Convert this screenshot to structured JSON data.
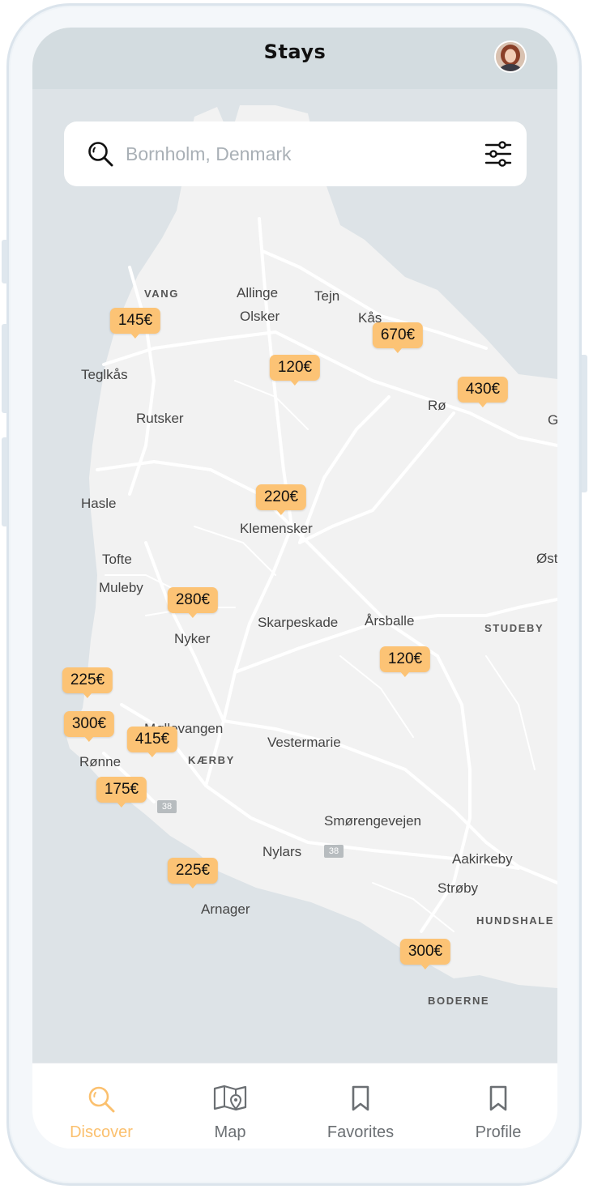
{
  "app": {
    "title": "Stays"
  },
  "search": {
    "placeholder": "Bornholm, Denmark",
    "value": ""
  },
  "colors": {
    "accent": "#fcc375",
    "active_tab": "#fbc06e",
    "map_water": "#dde3e7",
    "map_land": "#f2f2f2"
  },
  "map": {
    "places": [
      {
        "label": "VANG",
        "caps": true
      },
      {
        "label": "Allinge"
      },
      {
        "label": "Tejn"
      },
      {
        "label": "Olsker"
      },
      {
        "label": "Kås"
      },
      {
        "label": "Teglkås"
      },
      {
        "label": "Rø"
      },
      {
        "label": "G"
      },
      {
        "label": "Rutsker"
      },
      {
        "label": "Hasle"
      },
      {
        "label": "Klemensker"
      },
      {
        "label": "Øst"
      },
      {
        "label": "Tofte"
      },
      {
        "label": "Muleby"
      },
      {
        "label": "Nyker"
      },
      {
        "label": "Skarpeskade"
      },
      {
        "label": "Årsballe"
      },
      {
        "label": "STUDEBY",
        "caps": true
      },
      {
        "label": "Møllevangen"
      },
      {
        "label": "Vestermarie"
      },
      {
        "label": "Rønne"
      },
      {
        "label": "KÆRBY",
        "caps": true
      },
      {
        "label": "Smørengevejen"
      },
      {
        "label": "Nylars"
      },
      {
        "label": "Aakirkeby"
      },
      {
        "label": "Strøby"
      },
      {
        "label": "HUNDSHALE",
        "caps": true
      },
      {
        "label": "Arnager"
      },
      {
        "label": "BODERNE",
        "caps": true
      }
    ],
    "road_numbers": [
      "38",
      "38"
    ],
    "price_pins": [
      {
        "price": "145€"
      },
      {
        "price": "670€"
      },
      {
        "price": "120€"
      },
      {
        "price": "430€"
      },
      {
        "price": "220€"
      },
      {
        "price": "280€"
      },
      {
        "price": "120€"
      },
      {
        "price": "225€"
      },
      {
        "price": "300€"
      },
      {
        "price": "415€"
      },
      {
        "price": "175€"
      },
      {
        "price": "225€"
      },
      {
        "price": "300€"
      }
    ]
  },
  "tabs": [
    {
      "label": "Discover",
      "icon": "search-icon",
      "active": true
    },
    {
      "label": "Map",
      "icon": "map-icon",
      "active": false
    },
    {
      "label": "Favorites",
      "icon": "bookmark-icon",
      "active": false
    },
    {
      "label": "Profile",
      "icon": "bookmark-icon",
      "active": false
    }
  ]
}
